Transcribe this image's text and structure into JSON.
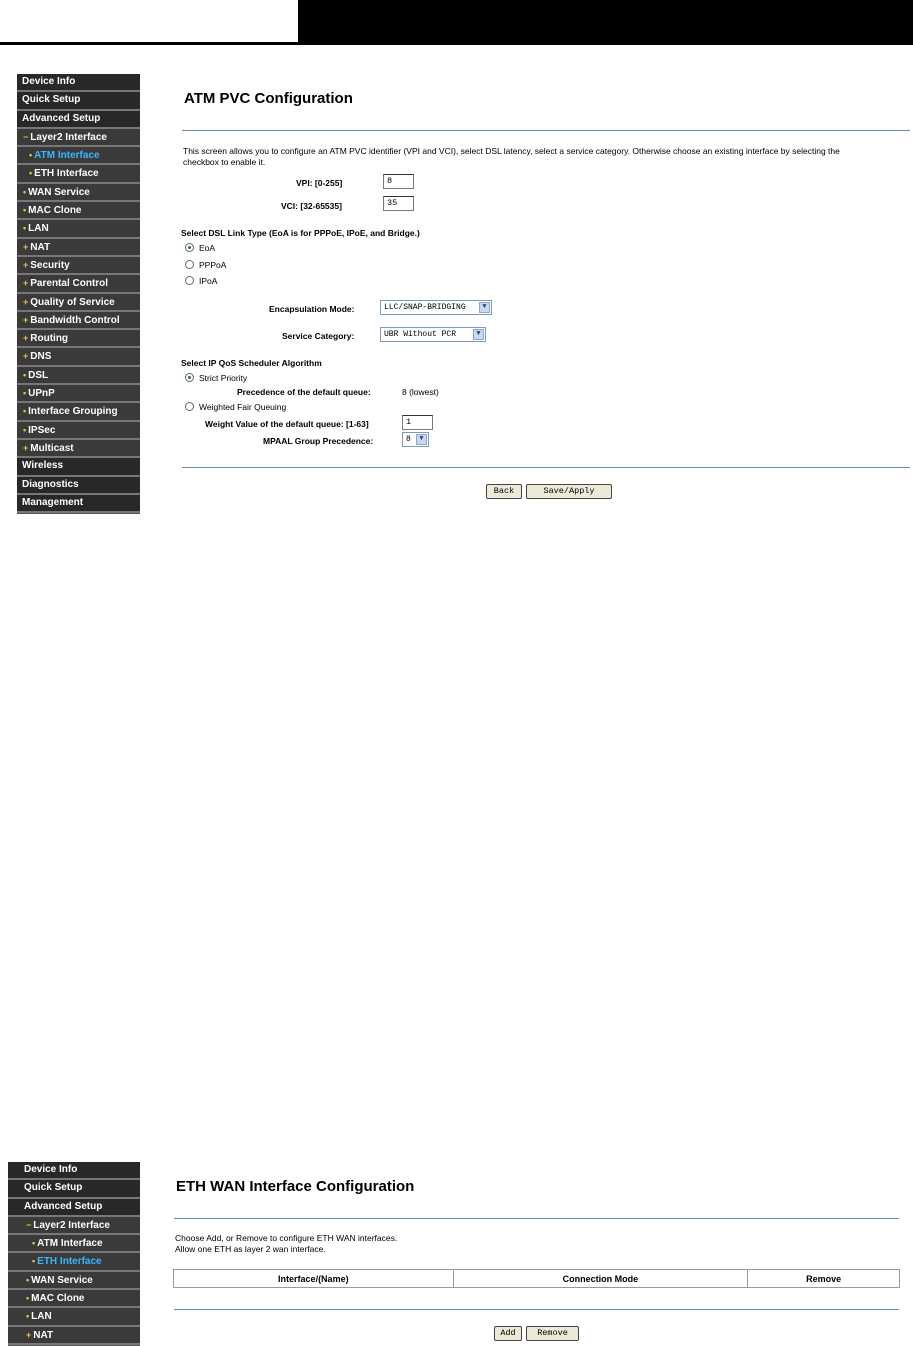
{
  "sidebar1": {
    "device_info": "Device Info",
    "quick_setup": "Quick Setup",
    "advanced_setup": "Advanced Setup",
    "layer2": "Layer2 Interface",
    "atm": "ATM Interface",
    "eth": "ETH Interface",
    "wan": "WAN Service",
    "mac": "MAC Clone",
    "lan": "LAN",
    "nat": "NAT",
    "security": "Security",
    "parental": "Parental Control",
    "qos": "Quality of Service",
    "bandwidth": "Bandwidth Control",
    "routing": "Routing",
    "dns": "DNS",
    "dsl": "DSL",
    "upnp": "UPnP",
    "grouping": "Interface Grouping",
    "ipsec": "IPSec",
    "multicast": "Multicast",
    "wireless": "Wireless",
    "diagnostics": "Diagnostics",
    "management": "Management"
  },
  "atm": {
    "title": "ATM PVC Configuration",
    "intro": "This screen allows you to configure an ATM PVC identifier (VPI and VCI), select DSL latency, select a service category. Otherwise choose an existing interface by selecting the",
    "intro2": "checkbox to enable it.",
    "vpi_label": "VPI: [0-255]",
    "vpi_value": "8",
    "vci_label": "VCI: [32-65535]",
    "vci_value": "35",
    "link_type_label": "Select DSL Link Type (EoA is for PPPoE, IPoE, and Bridge.)",
    "eoa": "EoA",
    "pppoa": "PPPoA",
    "ipoa": "IPoA",
    "encap_label": "Encapsulation Mode:",
    "encap_value": "LLC/SNAP-BRIDGING",
    "service_label": "Service Category:",
    "service_value": "UBR Without PCR",
    "qos_label": "Select IP QoS Scheduler Algorithm",
    "strict": "Strict Priority",
    "precedence_label": "Precedence of the default queue:",
    "precedence_value": "8 (lowest)",
    "wfq": "Weighted Fair Queuing",
    "weight_label": "Weight Value of the default queue: [1-63]",
    "weight_value": "1",
    "mpaal_label": "MPAAL Group Precedence:",
    "mpaal_value": "8",
    "back": "Back",
    "save": "Save/Apply"
  },
  "eth": {
    "title": "ETH WAN Interface Configuration",
    "intro1": "Choose Add, or Remove to configure ETH WAN interfaces.",
    "intro2": "Allow one ETH as layer 2 wan interface.",
    "col_interface": "Interface/(Name)",
    "col_mode": "Connection Mode",
    "col_remove": "Remove",
    "add": "Add",
    "remove": "Remove"
  },
  "colors": {
    "active_nav": "#38b8ff",
    "bullet": "#f0c040",
    "rule": "#6a8ab0"
  }
}
